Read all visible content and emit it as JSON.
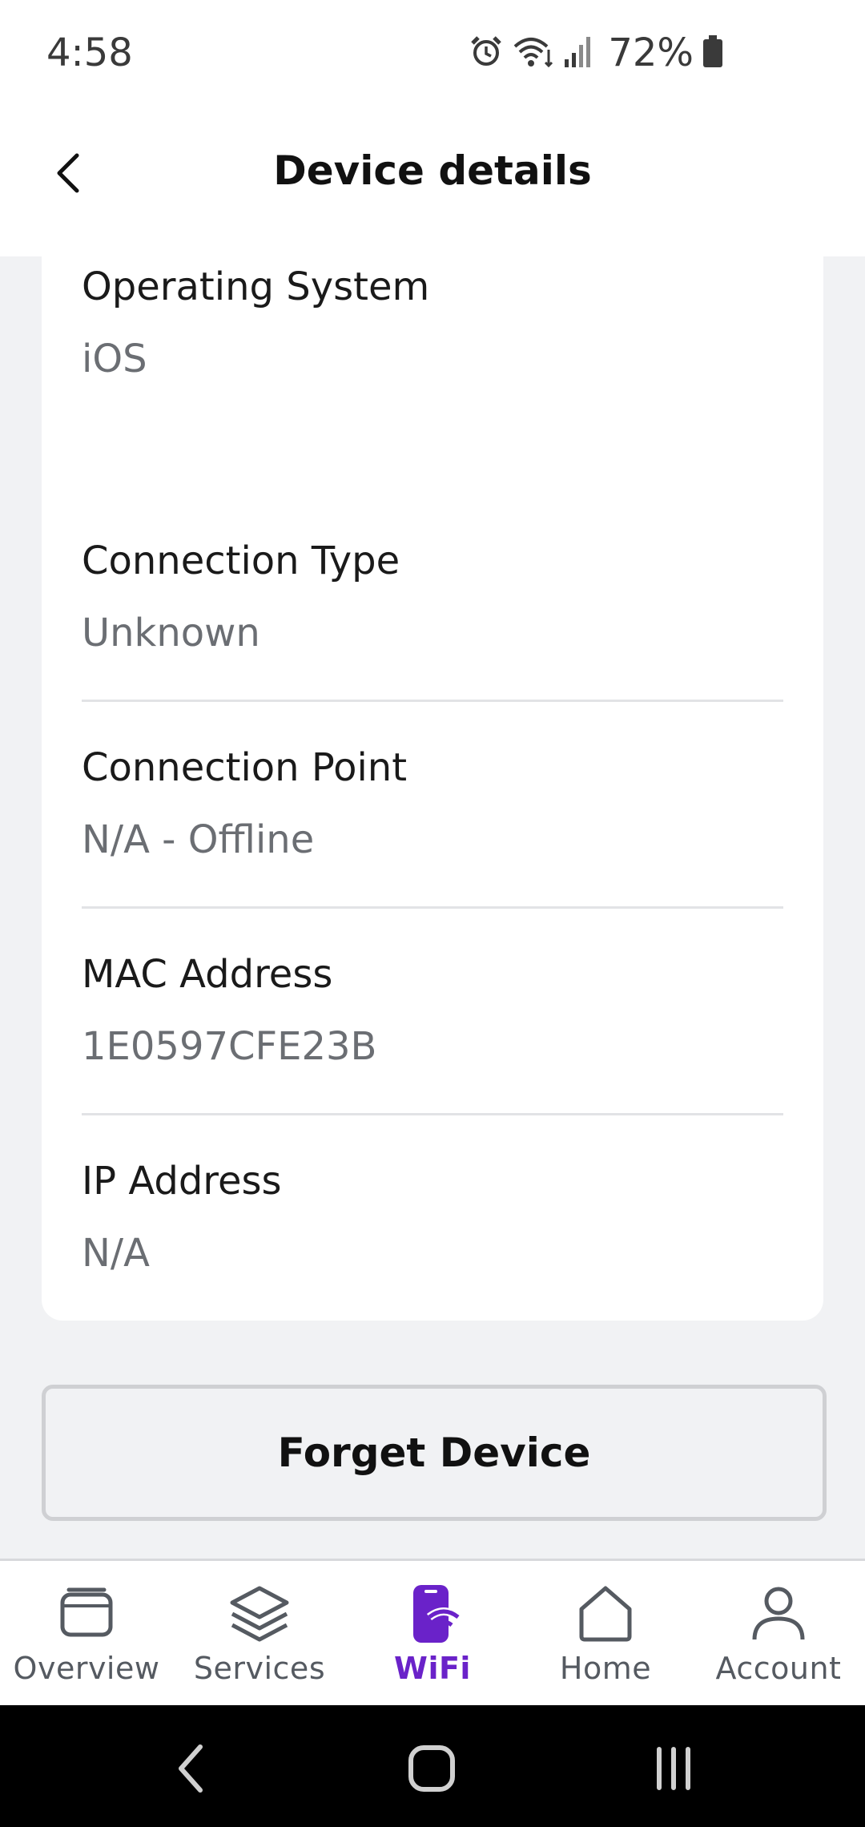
{
  "status_bar": {
    "time": "4:58",
    "battery": "72%",
    "icons": [
      "alarm-icon",
      "wifi-icon",
      "signal-icon",
      "battery-icon"
    ]
  },
  "header": {
    "title": "Device details",
    "back_icon": "chevron-left-icon"
  },
  "device_info": {
    "operating_system": {
      "label": "Operating System",
      "value": "iOS"
    },
    "connection_type": {
      "label": "Connection Type",
      "value": "Unknown"
    },
    "connection_point": {
      "label": "Connection Point",
      "value": "N/A - Offline"
    },
    "mac_address": {
      "label": "MAC Address",
      "value": "1E0597CFE23B"
    },
    "ip_address": {
      "label": "IP Address",
      "value": "N/A"
    }
  },
  "actions": {
    "forget_device_label": "Forget Device"
  },
  "bottom_nav": {
    "items": [
      {
        "label": "Overview",
        "icon": "overview-icon",
        "active": false
      },
      {
        "label": "Services",
        "icon": "layers-icon",
        "active": false
      },
      {
        "label": "WiFi",
        "icon": "wifi-device-icon",
        "active": true
      },
      {
        "label": "Home",
        "icon": "home-icon",
        "active": false
      },
      {
        "label": "Account",
        "icon": "person-icon",
        "active": false
      }
    ]
  },
  "colors": {
    "accent": "#6a22c9",
    "background": "#f1f2f4",
    "card": "#ffffff",
    "muted_text": "#6b6e73"
  }
}
